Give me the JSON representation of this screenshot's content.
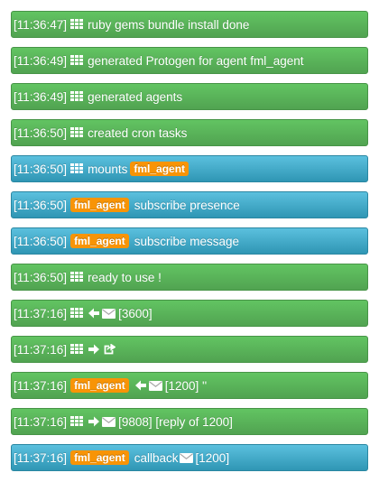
{
  "rows": [
    {
      "style": "green",
      "time": "[11:36:47]",
      "parts": [
        {
          "kind": "icon",
          "name": "th"
        },
        {
          "kind": "text",
          "value": "ruby gems bundle install done"
        }
      ]
    },
    {
      "style": "green",
      "time": "[11:36:49]",
      "parts": [
        {
          "kind": "icon",
          "name": "th"
        },
        {
          "kind": "text",
          "value": "generated Protogen for agent fml_agent"
        }
      ]
    },
    {
      "style": "green",
      "time": "[11:36:49]",
      "parts": [
        {
          "kind": "icon",
          "name": "th"
        },
        {
          "kind": "text",
          "value": "generated agents"
        }
      ]
    },
    {
      "style": "green",
      "time": "[11:36:50]",
      "parts": [
        {
          "kind": "icon",
          "name": "th"
        },
        {
          "kind": "text",
          "value": "created cron tasks"
        }
      ]
    },
    {
      "style": "blue",
      "time": "[11:36:50]",
      "parts": [
        {
          "kind": "icon",
          "name": "th"
        },
        {
          "kind": "text",
          "value": "mounts"
        },
        {
          "kind": "badge",
          "value": "fml_agent"
        }
      ]
    },
    {
      "style": "blue",
      "time": "[11:36:50]",
      "parts": [
        {
          "kind": "badge",
          "value": "fml_agent"
        },
        {
          "kind": "text",
          "value": "subscribe presence"
        }
      ]
    },
    {
      "style": "blue",
      "time": "[11:36:50]",
      "parts": [
        {
          "kind": "badge",
          "value": "fml_agent"
        },
        {
          "kind": "text",
          "value": "subscribe message"
        }
      ]
    },
    {
      "style": "green",
      "time": "[11:36:50]",
      "parts": [
        {
          "kind": "icon",
          "name": "th"
        },
        {
          "kind": "text",
          "value": "ready to use !"
        }
      ]
    },
    {
      "style": "green",
      "time": "[11:37:16]",
      "parts": [
        {
          "kind": "icon",
          "name": "th"
        },
        {
          "kind": "icon",
          "name": "arrow-left"
        },
        {
          "kind": "icon",
          "name": "envelope"
        },
        {
          "kind": "plain",
          "value": "[3600]"
        }
      ]
    },
    {
      "style": "green",
      "time": "[11:37:16]",
      "parts": [
        {
          "kind": "icon",
          "name": "th"
        },
        {
          "kind": "icon",
          "name": "arrow-right"
        },
        {
          "kind": "icon",
          "name": "share"
        }
      ]
    },
    {
      "style": "green",
      "time": "[11:37:16]",
      "parts": [
        {
          "kind": "badge",
          "value": "fml_agent"
        },
        {
          "kind": "icon",
          "name": "arrow-left"
        },
        {
          "kind": "icon",
          "name": "envelope"
        },
        {
          "kind": "plain",
          "value": "[1200] ''"
        }
      ]
    },
    {
      "style": "green",
      "time": "[11:37:16]",
      "parts": [
        {
          "kind": "icon",
          "name": "th"
        },
        {
          "kind": "icon",
          "name": "arrow-right"
        },
        {
          "kind": "icon",
          "name": "envelope"
        },
        {
          "kind": "plain",
          "value": "[9808] [reply of 1200]"
        }
      ]
    },
    {
      "style": "blue",
      "time": "[11:37:16]",
      "parts": [
        {
          "kind": "badge",
          "value": "fml_agent"
        },
        {
          "kind": "text",
          "value": "callback"
        },
        {
          "kind": "icon",
          "name": "envelope"
        },
        {
          "kind": "plain",
          "value": "[1200]"
        }
      ]
    }
  ]
}
